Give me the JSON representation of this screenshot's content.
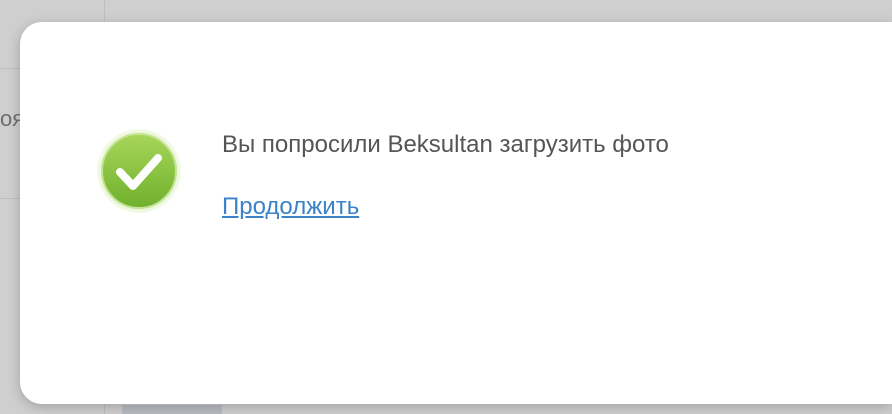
{
  "background": {
    "fragment_text": "оя"
  },
  "dialog": {
    "icon": "checkmark-success-icon",
    "message": "Вы попросили Beksultan загрузить фото",
    "continue_link": "Продолжить"
  },
  "colors": {
    "icon_green": "#8cc63f",
    "link_blue": "#3b83c8",
    "message_gray": "#555555",
    "overlay": "#cfcfcf"
  }
}
